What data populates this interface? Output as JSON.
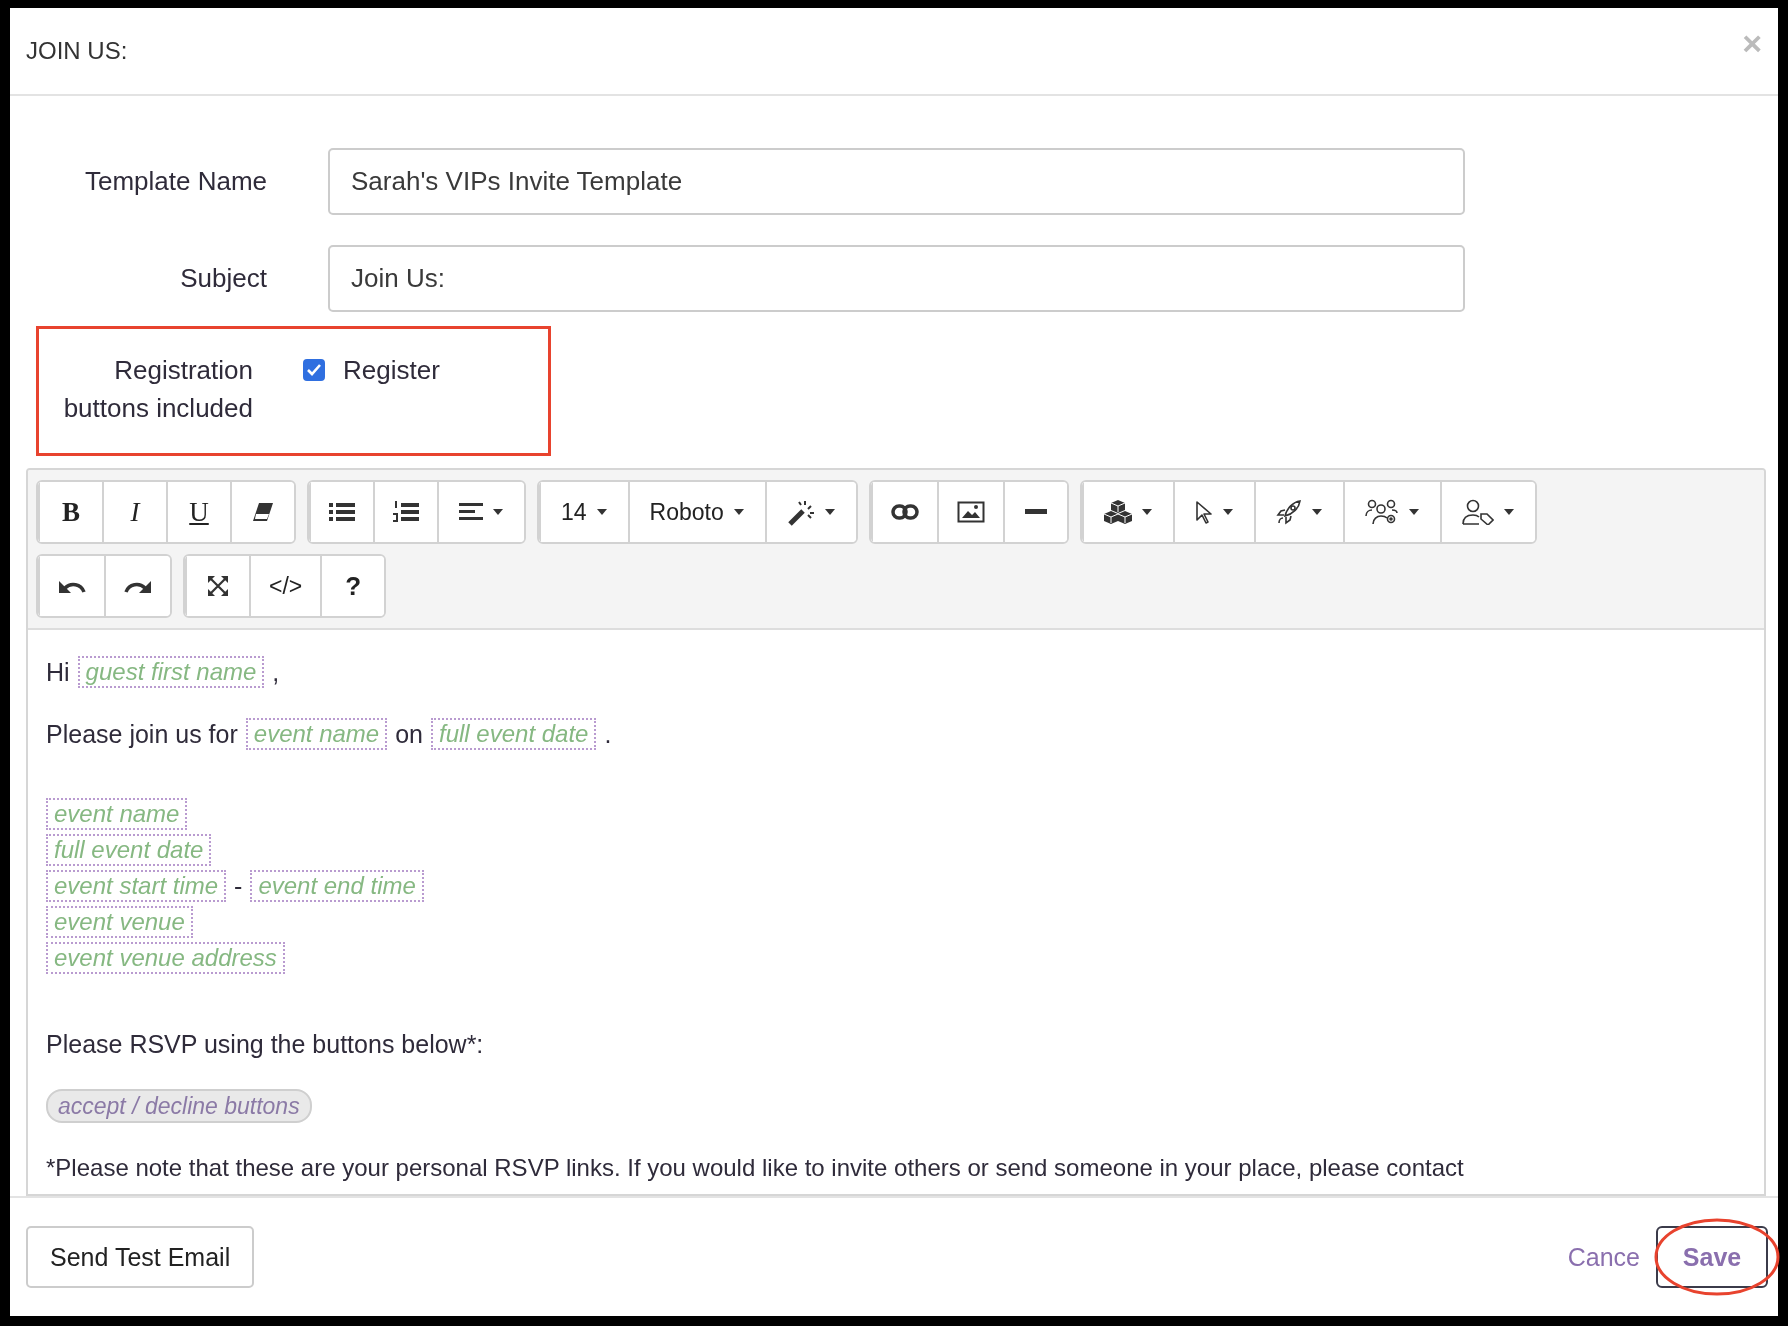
{
  "dialog": {
    "title": "JOIN US:",
    "close": "×"
  },
  "fields": [
    {
      "label": "Template Name",
      "value": "Sarah's VIPs Invite Template"
    },
    {
      "label": "Subject",
      "value": "Join Us:"
    }
  ],
  "registration": {
    "label": "Registration buttons included",
    "option": "Register",
    "checked": true
  },
  "toolbar": {
    "rows": [
      [
        [
          {
            "kind": "bold",
            "label": "B",
            "dropdown": false
          },
          {
            "kind": "italic",
            "label": "I",
            "dropdown": false
          },
          {
            "kind": "underline",
            "label": "U",
            "dropdown": false
          },
          {
            "kind": "eraser",
            "dropdown": false
          }
        ],
        [
          {
            "kind": "bullets",
            "dropdown": false
          },
          {
            "kind": "numbers",
            "dropdown": false
          },
          {
            "kind": "align",
            "dropdown": true
          }
        ],
        [
          {
            "kind": "text",
            "label": "14",
            "dropdown": true
          },
          {
            "kind": "text",
            "label": "Roboto",
            "dropdown": true
          },
          {
            "kind": "magic",
            "dropdown": true
          }
        ],
        [
          {
            "kind": "link",
            "dropdown": false
          },
          {
            "kind": "image",
            "dropdown": false
          },
          {
            "kind": "rule",
            "dropdown": false
          }
        ],
        [
          {
            "kind": "cubes",
            "dropdown": true
          },
          {
            "kind": "cursor",
            "dropdown": true
          },
          {
            "kind": "rocket",
            "dropdown": true
          },
          {
            "kind": "group",
            "dropdown": true
          },
          {
            "kind": "usertag",
            "dropdown": true
          }
        ]
      ],
      [
        [
          {
            "kind": "undo",
            "dropdown": false
          },
          {
            "kind": "redo",
            "dropdown": false
          }
        ],
        [
          {
            "kind": "expand",
            "dropdown": false
          },
          {
            "kind": "text",
            "label": "</>",
            "dropdown": false
          },
          {
            "kind": "help",
            "label": "?",
            "dropdown": false
          }
        ]
      ]
    ]
  },
  "body": [
    {
      "lines": [
        [
          {
            "kind": "text",
            "text": "Hi"
          },
          {
            "kind": "tag",
            "text": "guest first name"
          },
          {
            "kind": "text",
            "text": ","
          }
        ]
      ]
    },
    {
      "lines": [
        [
          {
            "kind": "text",
            "text": "Please join us for"
          },
          {
            "kind": "tag",
            "text": "event name"
          },
          {
            "kind": "text",
            "text": "on"
          },
          {
            "kind": "tag",
            "text": "full event date"
          },
          {
            "kind": "text",
            "text": "."
          }
        ]
      ]
    },
    {
      "lines": [
        [
          {
            "kind": "tag",
            "text": "event name"
          }
        ],
        [
          {
            "kind": "tag",
            "text": "full event date"
          }
        ],
        [
          {
            "kind": "tag",
            "text": "event start time"
          },
          {
            "kind": "text",
            "text": "-"
          },
          {
            "kind": "tag",
            "text": "event end time"
          }
        ],
        [
          {
            "kind": "tag",
            "text": "event venue"
          }
        ],
        [
          {
            "kind": "tag",
            "text": "event venue address"
          }
        ]
      ]
    },
    {
      "lines": [
        [
          {
            "kind": "text",
            "text": "Please RSVP using the buttons below*:"
          }
        ]
      ]
    },
    {
      "lines": [
        [
          {
            "kind": "buttons",
            "text": "accept / decline buttons"
          }
        ]
      ]
    },
    {
      "lines": [
        [
          {
            "kind": "text",
            "text": "*Please note that these are your personal RSVP links. If you would like to invite others or send someone in your place, please contact"
          }
        ]
      ]
    }
  ],
  "footer": {
    "test": "Send Test Email",
    "cancel": "Cance",
    "save": "Save"
  }
}
